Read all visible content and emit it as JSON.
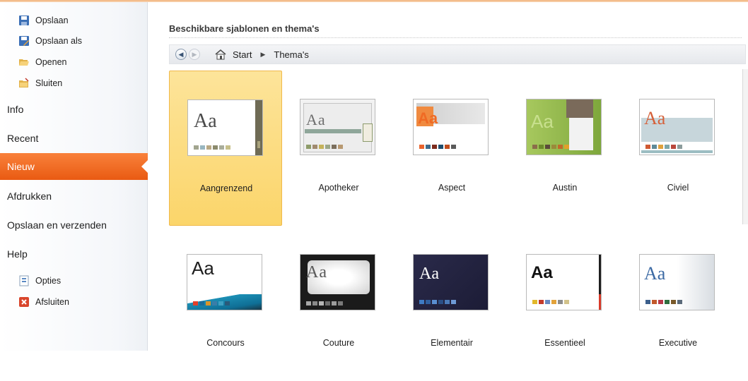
{
  "sidebar": {
    "small_top": [
      {
        "label": "Opslaan",
        "icon": "save-icon"
      },
      {
        "label": "Opslaan als",
        "icon": "save-as-icon"
      },
      {
        "label": "Openen",
        "icon": "open-folder-icon"
      },
      {
        "label": "Sluiten",
        "icon": "close-folder-icon"
      }
    ],
    "big": [
      {
        "label": "Info"
      },
      {
        "label": "Recent"
      },
      {
        "label": "Nieuw",
        "active": true
      },
      {
        "label": "Afdrukken"
      },
      {
        "label": "Opslaan en verzenden"
      },
      {
        "label": "Help"
      }
    ],
    "small_bottom": [
      {
        "label": "Opties",
        "icon": "options-icon"
      },
      {
        "label": "Afsluiten",
        "icon": "exit-icon"
      }
    ]
  },
  "main": {
    "title": "Beschikbare sjablonen en thema's",
    "breadcrumb": {
      "start": "Start",
      "current": "Thema's"
    },
    "themes": [
      {
        "name": "Aangrenzend",
        "selected": true
      },
      {
        "name": "Apotheker"
      },
      {
        "name": "Aspect"
      },
      {
        "name": "Austin"
      },
      {
        "name": "Civiel"
      },
      {
        "name": "Concours"
      },
      {
        "name": "Couture"
      },
      {
        "name": "Elementair"
      },
      {
        "name": "Essentieel"
      },
      {
        "name": "Executive"
      }
    ],
    "thumb_text": "Aa"
  },
  "colors": {
    "accent": "#e95a12",
    "selection": "#fbd56a"
  }
}
